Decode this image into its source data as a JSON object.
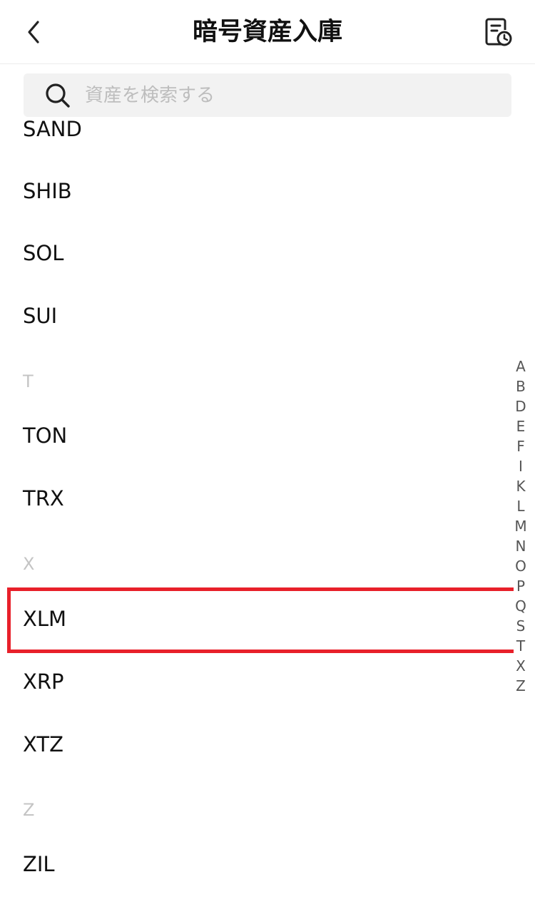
{
  "header": {
    "title": "暗号資産入庫",
    "back_icon": "chevron-left-icon",
    "history_icon": "document-clock-icon"
  },
  "search": {
    "placeholder": "資産を検索する",
    "value": ""
  },
  "list": {
    "items": [
      {
        "label": "SAND"
      },
      {
        "label": "SHIB"
      },
      {
        "label": "SOL"
      },
      {
        "label": "SUI"
      },
      {
        "section": "T"
      },
      {
        "label": "TON"
      },
      {
        "label": "TRX"
      },
      {
        "section": "X"
      },
      {
        "label": "XLM",
        "selected": true
      },
      {
        "label": "XRP"
      },
      {
        "label": "XTZ"
      },
      {
        "section": "Z"
      },
      {
        "label": "ZIL"
      }
    ]
  },
  "index": {
    "letters": [
      "A",
      "B",
      "D",
      "E",
      "F",
      "I",
      "K",
      "L",
      "M",
      "N",
      "O",
      "P",
      "Q",
      "S",
      "T",
      "X",
      "Z"
    ]
  },
  "colors": {
    "highlight": "#e8202a",
    "section_header": "#c4c4c4"
  }
}
